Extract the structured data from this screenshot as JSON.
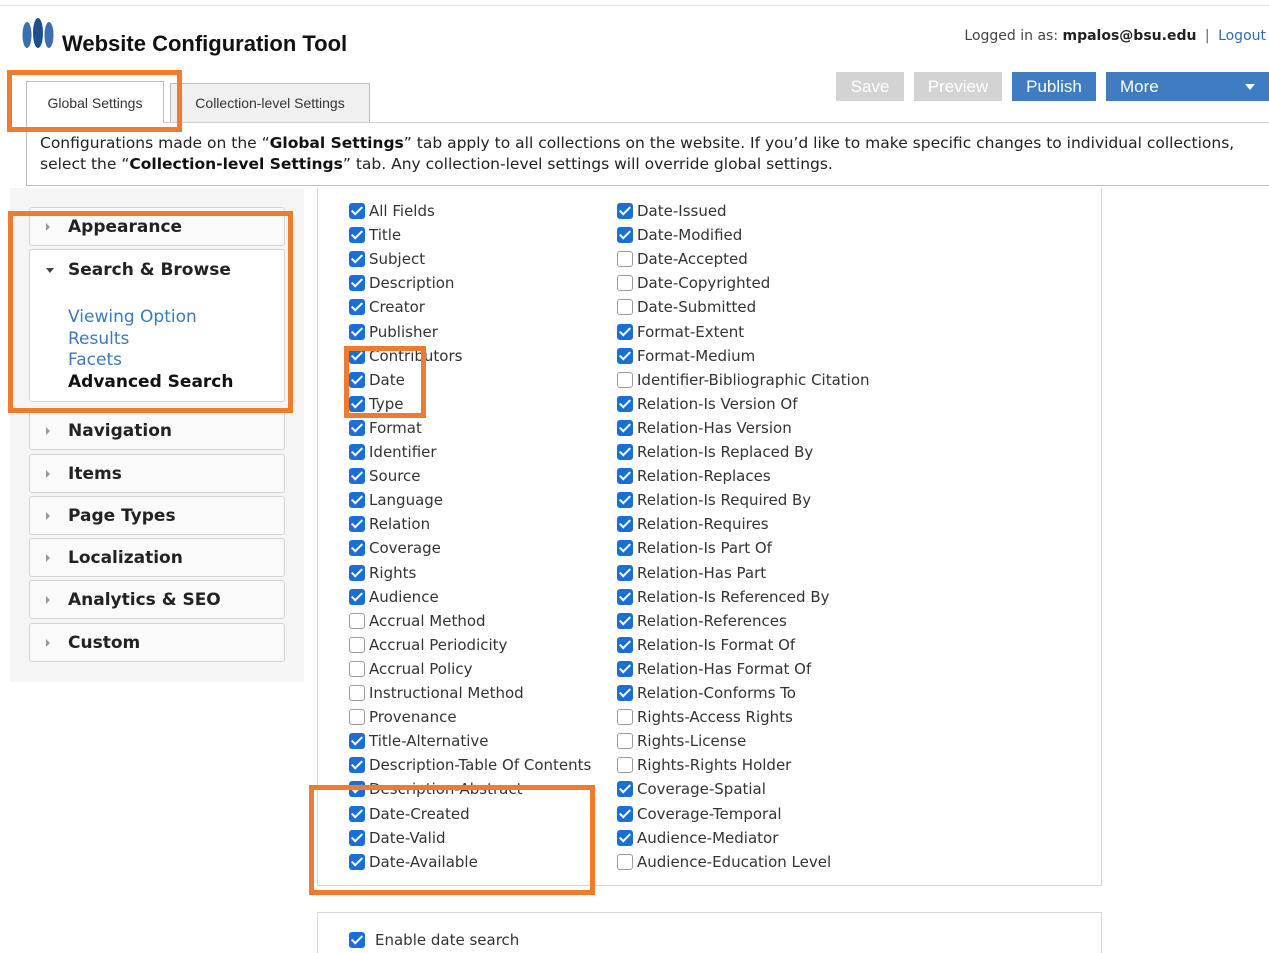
{
  "header": {
    "app_title": "Website Configuration Tool",
    "logged_in_label": "Logged in as:",
    "user": "mpalos@bsu.edu",
    "separator": "|",
    "logout": "Logout"
  },
  "toolbar": {
    "save": "Save",
    "preview": "Preview",
    "publish": "Publish",
    "more": "More"
  },
  "tabs": {
    "global": "Global Settings",
    "collection": "Collection-level Settings"
  },
  "description": {
    "part1": "Configurations made on the “",
    "bold1": "Global Settings",
    "part2": "” tab apply to all collections on the website. If you’d like to make specific changes to individual collections, select the “",
    "bold2": "Collection-level Settings",
    "part3": "” tab. Any collection-level settings will override global settings."
  },
  "sidebar": {
    "appearance": "Appearance",
    "search_browse": "Search & Browse",
    "sub_items": [
      "Viewing Option",
      "Results",
      "Facets",
      "Advanced Search"
    ],
    "navigation": "Navigation",
    "items": "Items",
    "page_types": "Page Types",
    "localization": "Localization",
    "analytics": "Analytics & SEO",
    "custom": "Custom"
  },
  "fields_col1": [
    {
      "label": "All Fields",
      "checked": true
    },
    {
      "label": "Title",
      "checked": true
    },
    {
      "label": "Subject",
      "checked": true
    },
    {
      "label": "Description",
      "checked": true
    },
    {
      "label": "Creator",
      "checked": true
    },
    {
      "label": "Publisher",
      "checked": true
    },
    {
      "label": "Contributors",
      "checked": true
    },
    {
      "label": "Date",
      "checked": true
    },
    {
      "label": "Type",
      "checked": true
    },
    {
      "label": "Format",
      "checked": true
    },
    {
      "label": "Identifier",
      "checked": true
    },
    {
      "label": "Source",
      "checked": true
    },
    {
      "label": "Language",
      "checked": true
    },
    {
      "label": "Relation",
      "checked": true
    },
    {
      "label": "Coverage",
      "checked": true
    },
    {
      "label": "Rights",
      "checked": true
    },
    {
      "label": "Audience",
      "checked": true
    },
    {
      "label": "Accrual Method",
      "checked": false
    },
    {
      "label": "Accrual Periodicity",
      "checked": false
    },
    {
      "label": "Accrual Policy",
      "checked": false
    },
    {
      "label": "Instructional Method",
      "checked": false
    },
    {
      "label": "Provenance",
      "checked": false
    },
    {
      "label": "Title-Alternative",
      "checked": true
    },
    {
      "label": "Description-Table Of Contents",
      "checked": true
    },
    {
      "label": "Description-Abstract",
      "checked": true
    },
    {
      "label": "Date-Created",
      "checked": true
    },
    {
      "label": "Date-Valid",
      "checked": true
    },
    {
      "label": "Date-Available",
      "checked": true
    }
  ],
  "fields_col2": [
    {
      "label": "Date-Issued",
      "checked": true
    },
    {
      "label": "Date-Modified",
      "checked": true
    },
    {
      "label": "Date-Accepted",
      "checked": false
    },
    {
      "label": "Date-Copyrighted",
      "checked": false
    },
    {
      "label": "Date-Submitted",
      "checked": false
    },
    {
      "label": "Format-Extent",
      "checked": true
    },
    {
      "label": "Format-Medium",
      "checked": true
    },
    {
      "label": "Identifier-Bibliographic Citation",
      "checked": false
    },
    {
      "label": "Relation-Is Version Of",
      "checked": true
    },
    {
      "label": "Relation-Has Version",
      "checked": true
    },
    {
      "label": "Relation-Is Replaced By",
      "checked": true
    },
    {
      "label": "Relation-Replaces",
      "checked": true
    },
    {
      "label": "Relation-Is Required By",
      "checked": true
    },
    {
      "label": "Relation-Requires",
      "checked": true
    },
    {
      "label": "Relation-Is Part Of",
      "checked": true
    },
    {
      "label": "Relation-Has Part",
      "checked": true
    },
    {
      "label": "Relation-Is Referenced By",
      "checked": true
    },
    {
      "label": "Relation-References",
      "checked": true
    },
    {
      "label": "Relation-Is Format Of",
      "checked": true
    },
    {
      "label": "Relation-Has Format Of",
      "checked": true
    },
    {
      "label": "Relation-Conforms To",
      "checked": true
    },
    {
      "label": "Rights-Access Rights",
      "checked": false
    },
    {
      "label": "Rights-License",
      "checked": false
    },
    {
      "label": "Rights-Rights Holder",
      "checked": false
    },
    {
      "label": "Coverage-Spatial",
      "checked": true
    },
    {
      "label": "Coverage-Temporal",
      "checked": true
    },
    {
      "label": "Audience-Mediator",
      "checked": true
    },
    {
      "label": "Audience-Education Level",
      "checked": false
    }
  ],
  "date_search": {
    "label": "Enable date search",
    "checked": true
  },
  "colors": {
    "accent": "#3f7cc2",
    "checkbox": "#1a6fd6",
    "highlight": "#ee7b2e",
    "link": "#3d7ab8"
  }
}
